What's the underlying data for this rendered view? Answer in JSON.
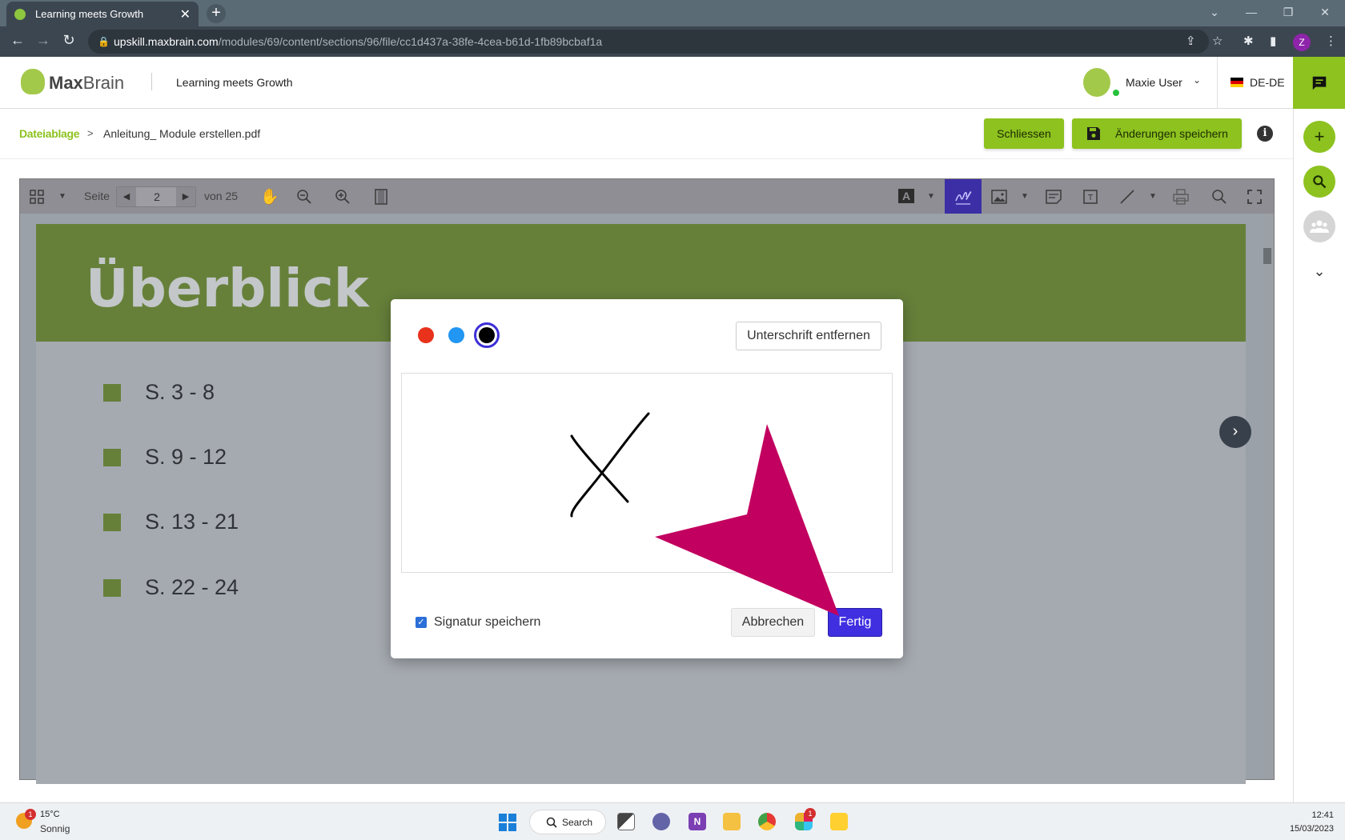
{
  "browser": {
    "tab_title": "Learning meets Growth",
    "url_domain": "upskill.maxbrain.com",
    "url_path": "/modules/69/content/sections/96/file/cc1d437a-38fe-4cea-b61d-1fb89bcbaf1a",
    "profile_initial": "Z"
  },
  "header": {
    "logo_max": "Max",
    "logo_brain": "Brain",
    "tagline": "Learning meets Growth",
    "username": "Maxie User",
    "language": "DE-DE"
  },
  "breadcrumb": {
    "root": "Dateiablage",
    "separator": ">",
    "file": "Anleitung_ Module erstellen.pdf"
  },
  "actions": {
    "close_label": "Schliessen",
    "save_label": "Änderungen speichern"
  },
  "viewer": {
    "page_label": "Seite",
    "current_page": "2",
    "total_label": "von 25"
  },
  "document": {
    "title": "Überblick",
    "items": [
      "S. 3 - 8",
      "S. 9 - 12",
      "S. 13 - 21",
      "S. 22 - 24"
    ]
  },
  "signature_dialog": {
    "colors": [
      "#e8321c",
      "#2196f3",
      "#000000"
    ],
    "selected_color": "#000000",
    "remove_label": "Unterschrift entfernen",
    "save_signature_label": "Signatur speichern",
    "save_signature_checked": true,
    "cancel_label": "Abbrechen",
    "done_label": "Fertig"
  },
  "annotation": {
    "arrow_color": "#c2005f"
  },
  "taskbar": {
    "weather_badge": "1",
    "temperature": "15°C",
    "condition": "Sonnig",
    "search_label": "Search",
    "slack_badge": "1",
    "time": "12:41",
    "date": "15/03/2023"
  },
  "colors": {
    "brand_green": "#8dc21f",
    "primary_blue": "#3f2fe0"
  }
}
